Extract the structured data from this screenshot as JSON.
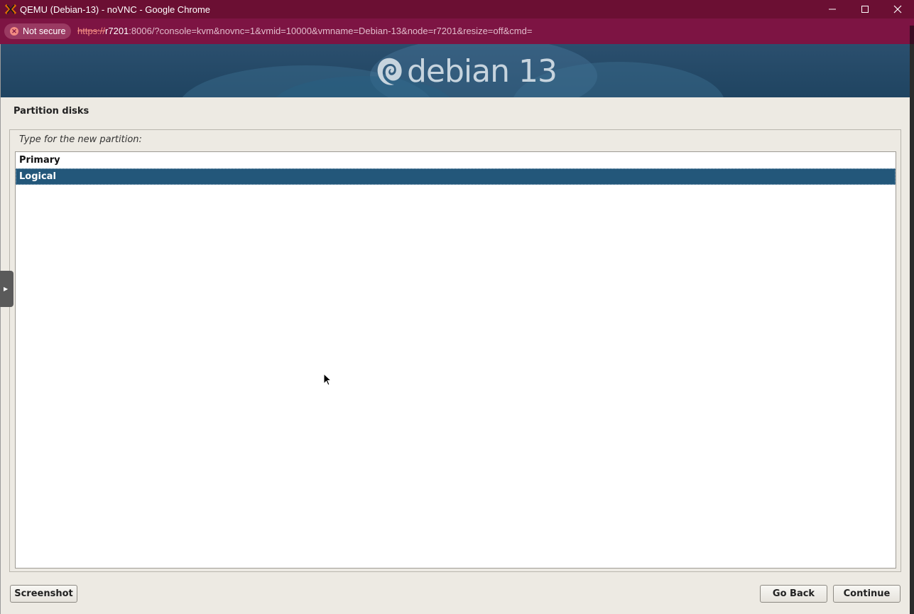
{
  "window": {
    "title": "QEMU (Debian-13) - noVNC - Google Chrome",
    "app_icon": "proxmox-x-icon",
    "controls": [
      "minimize-icon",
      "maximize-icon",
      "close-icon"
    ],
    "colors": {
      "titlebar": "#6b0f33",
      "addressbar": "#7d1443"
    }
  },
  "addressbar": {
    "security_label": "Not secure",
    "url_scheme": "https://",
    "url_host": "r7201",
    "url_rest": ":8006/?console=kvm&novnc=1&vmid=10000&vmname=Debian-13&node=r7201&resize=off&cmd="
  },
  "banner": {
    "logo_icon": "debian-swirl-icon",
    "wordmark": "debian 13"
  },
  "installer": {
    "page_title": "Partition disks",
    "prompt": "Type for the new partition:",
    "options": [
      {
        "label": "Primary",
        "selected": false
      },
      {
        "label": "Logical",
        "selected": true
      }
    ],
    "buttons": {
      "screenshot": "Screenshot",
      "go_back": "Go Back",
      "continue": "Continue"
    },
    "colors": {
      "selection": "#23577a",
      "background": "#edeae3"
    }
  }
}
